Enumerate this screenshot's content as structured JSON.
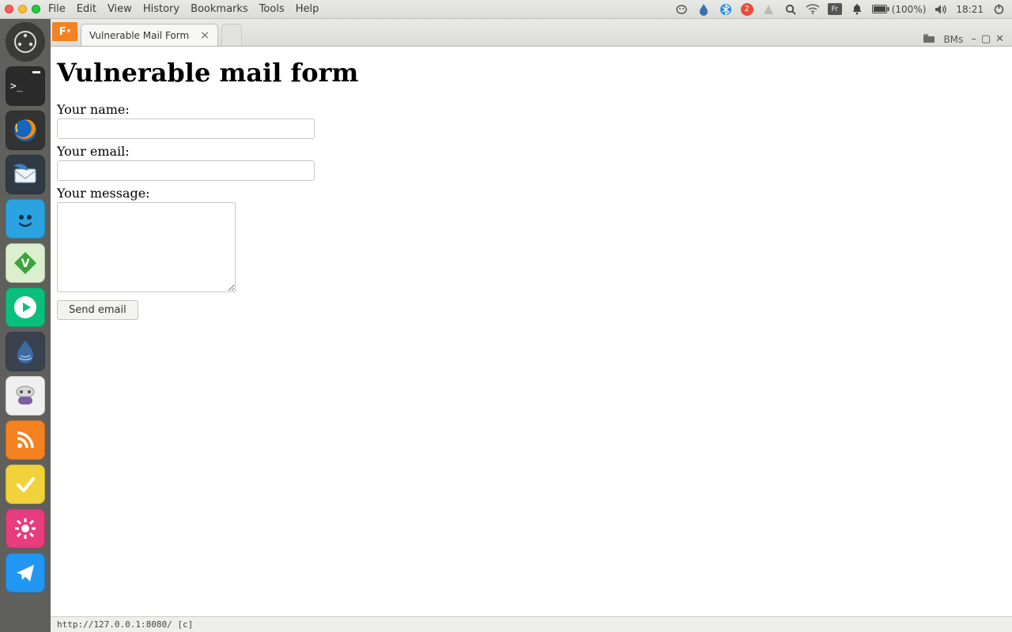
{
  "menubar": {
    "items": [
      "File",
      "Edit",
      "View",
      "History",
      "Bookmarks",
      "Tools",
      "Help"
    ],
    "notification_badge": "2",
    "keyboard_layout": "Fr",
    "battery": "(100%)",
    "clock": "18:21"
  },
  "browser": {
    "tab_title": "Vulnerable Mail Form",
    "bookmark_folder": "BMs"
  },
  "page": {
    "heading": "Vulnerable mail form",
    "labels": {
      "name": "Your name:",
      "email": "Your email:",
      "message": "Your message:"
    },
    "inputs": {
      "name": "",
      "email": "",
      "message": ""
    },
    "submit": "Send email"
  },
  "status_bar": "http://127.0.0.1:8080/ [c]"
}
